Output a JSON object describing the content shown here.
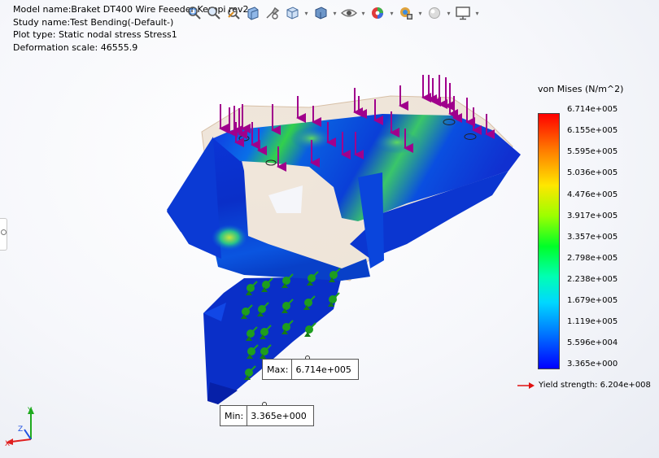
{
  "header": {
    "model_line": "Model name:Braket DT400 Wire Feeeder Kerppi rev2",
    "study_line": "Study name:Test Bending(-Default-)",
    "plot_line": "Plot type: Static nodal stress Stress1",
    "deform_line": "Deformation scale: 46555.9"
  },
  "toolbar": {
    "icons": [
      "zoom-to-fit-icon",
      "zoom-to-area-icon",
      "previous-view-icon",
      "section-view-icon",
      "view-settings-icon",
      "view-orientation-icon",
      "display-style-icon",
      "hide-show-items-icon",
      "edit-appearance-icon",
      "apply-scene-icon",
      "view-setting-icon",
      "display-pane-icon"
    ]
  },
  "legend": {
    "title": "von Mises (N/m^2)",
    "ticks": [
      "6.714e+005",
      "6.155e+005",
      "5.595e+005",
      "5.036e+005",
      "4.476e+005",
      "3.917e+005",
      "3.357e+005",
      "2.798e+005",
      "2.238e+005",
      "1.679e+005",
      "1.119e+005",
      "5.596e+004",
      "3.365e+000"
    ],
    "yield_label": "Yield strength: 6.204e+008",
    "colors": {
      "high": "#ff0000",
      "mid": "#00ff28",
      "low": "#0000ff",
      "yield_arrow": "#ff0000"
    }
  },
  "probes": {
    "max_label": "Max:",
    "max_value": "6.714e+005",
    "min_label": "Min:",
    "min_value": "3.365e+000"
  },
  "triad": {
    "x_label": "X",
    "y_label": "Y",
    "z_label": "Z"
  },
  "colors": {
    "loads": "#a0008c",
    "fixtures": "#1e9e1e",
    "mesh_blue": "#0a2fd0"
  }
}
